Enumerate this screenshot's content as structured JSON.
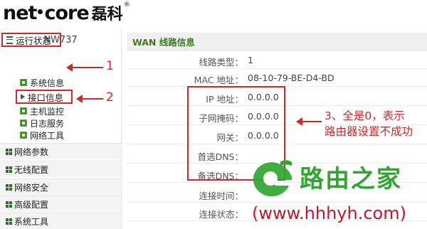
{
  "brand": {
    "name_latin_1": "net",
    "name_latin_2": "core",
    "name_cn": "磊科",
    "reg_mark": "®"
  },
  "sidebar": {
    "model": "NW737",
    "status_label": "运行状态",
    "sub_items": [
      {
        "label": "系统信息",
        "active": false
      },
      {
        "label": "接口信息",
        "active": true
      },
      {
        "label": "主机监控",
        "active": false
      },
      {
        "label": "日志服务",
        "active": false
      },
      {
        "label": "网络工具",
        "active": false
      }
    ],
    "menu": [
      {
        "label": "网络参数"
      },
      {
        "label": "无线配置"
      },
      {
        "label": "网络安全"
      },
      {
        "label": "高级配置"
      },
      {
        "label": "系统工具"
      }
    ]
  },
  "panel": {
    "title": "WAN 线路信息",
    "rows": [
      {
        "label": "线路类型：",
        "value": "1"
      },
      {
        "label": "MAC 地址：",
        "value": "08-10-79-BE-D4-BD"
      },
      {
        "label": "IP 地址：",
        "value": "0.0.0.0"
      },
      {
        "label": "子网掩码：",
        "value": "0.0.0.0"
      },
      {
        "label": "网关：",
        "value": "0.0.0.0"
      },
      {
        "label": "首选DNS：",
        "value": ""
      },
      {
        "label": "备选DNS：",
        "value": ""
      },
      {
        "label": "连接时间：",
        "value": ""
      },
      {
        "label": "连接状态：",
        "value": ""
      }
    ]
  },
  "annotations": {
    "step1": "1",
    "step2": "2",
    "step3_line1": "3、全是0，表示",
    "step3_line2": "路由器设置不成功"
  },
  "watermark": {
    "text": "路由之家",
    "url": "(www.hhhyh.com)"
  },
  "colors": {
    "accent_red": "#d8242a",
    "brand_green": "#3a7d20",
    "watermark_green": "#2fa62f"
  }
}
